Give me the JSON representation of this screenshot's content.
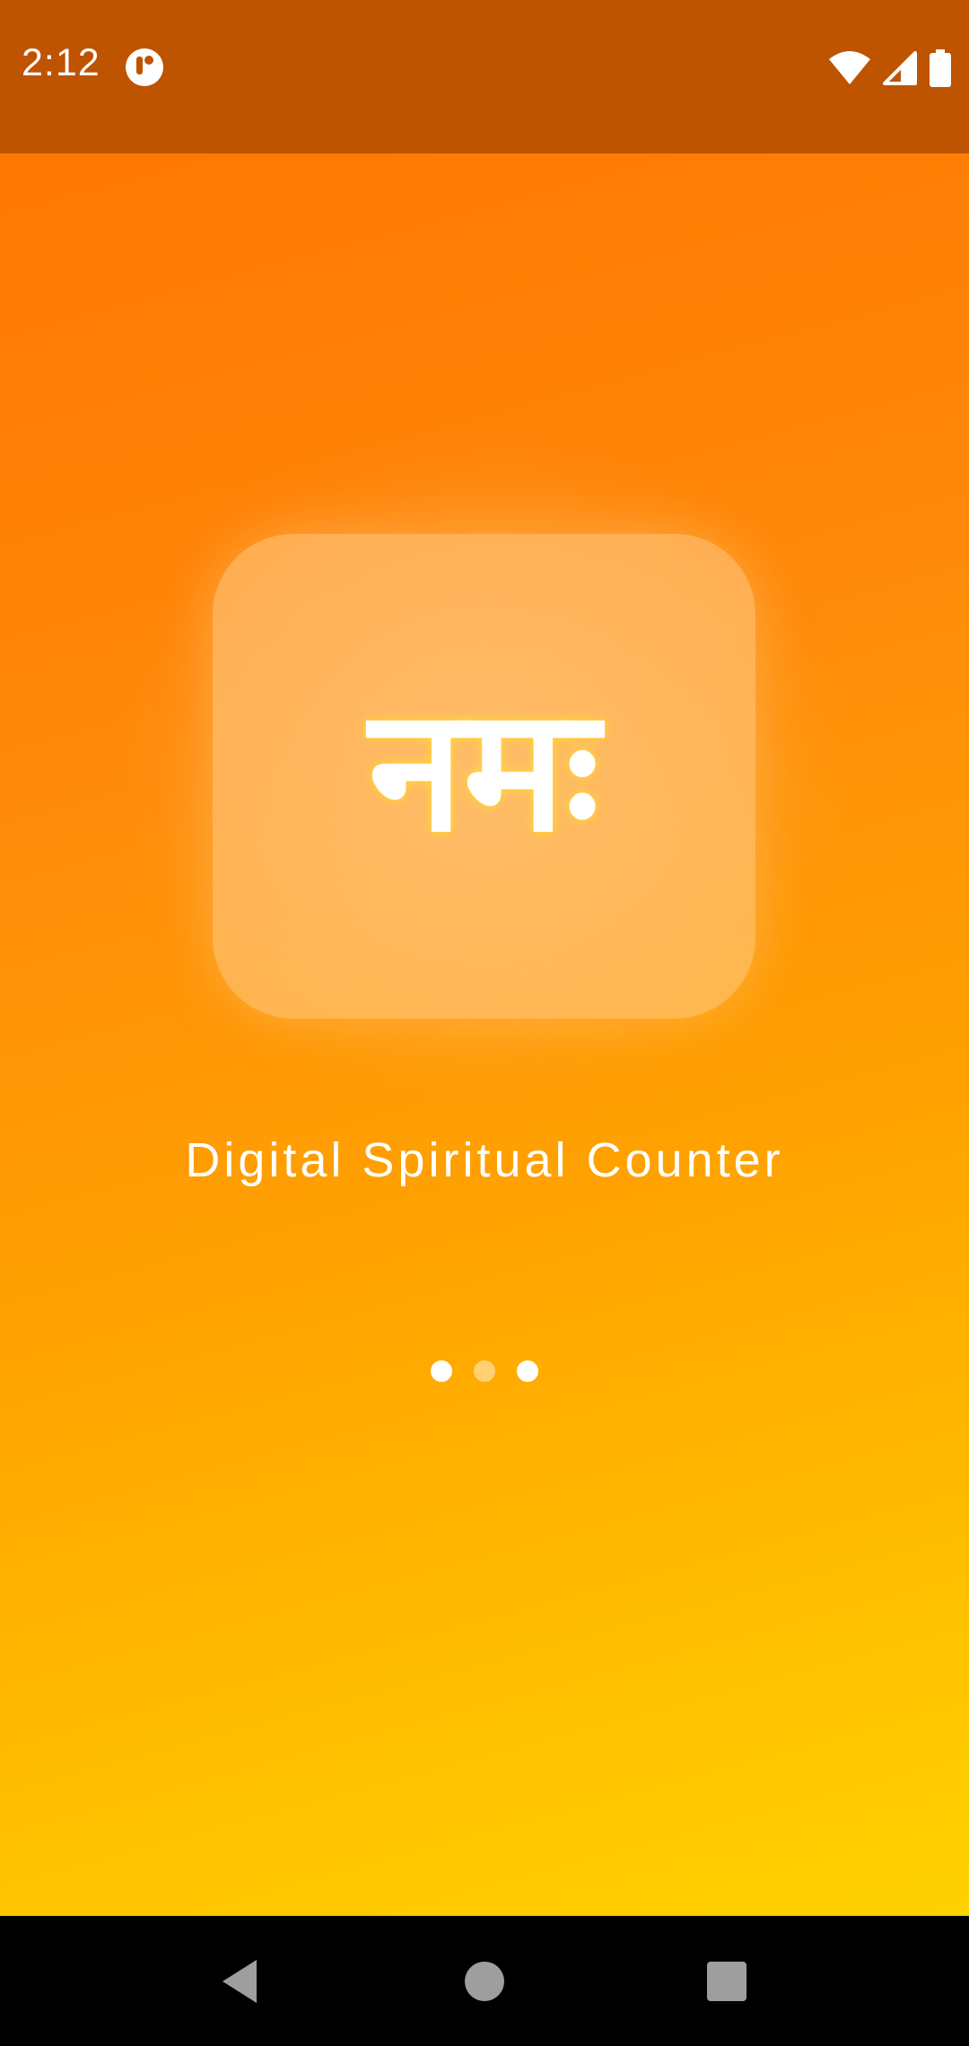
{
  "status_bar": {
    "time": "2:12",
    "icons": [
      "app-notification-icon",
      "wifi-icon",
      "cell-signal-icon",
      "battery-icon"
    ]
  },
  "splash": {
    "logo_text": "नमः",
    "tagline": "Digital Spiritual Counter",
    "loading_dots": 3
  },
  "navigation": {
    "buttons": [
      "back-icon",
      "home-icon",
      "recents-icon"
    ]
  },
  "colors": {
    "status_bar": "#be5300",
    "gradient_top": "#ff7300",
    "gradient_bottom": "#ffd800",
    "text": "#ffffff"
  }
}
